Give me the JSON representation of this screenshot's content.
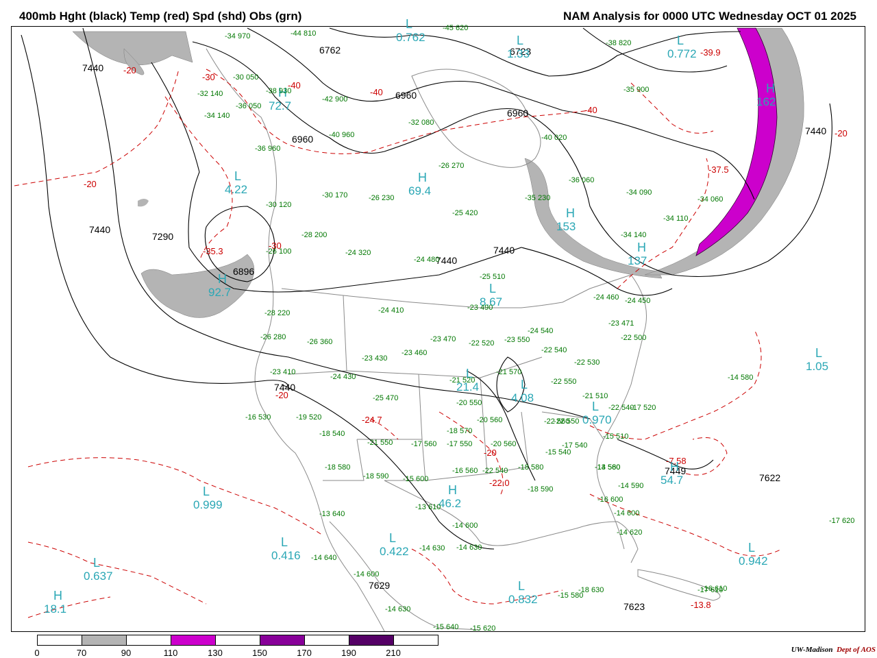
{
  "header": {
    "title_left": "400mb Hght (black) Temp (red) Spd (shd) Obs (grn)",
    "title_right": "NAM Analysis for 0000 UTC Wednesday  OCT 01 2025"
  },
  "colors": {
    "height": "#000000",
    "temp": "#cc0000",
    "obs": "#007700",
    "speed_label": "#2aa7b5",
    "shade_70_90": "#b4b4b4",
    "shade_110_130": "#cc00cc",
    "shade_150_170": "#880099",
    "shade_190_210": "#550066"
  },
  "legend": {
    "ticks": [
      "0",
      "70",
      "90",
      "110",
      "130",
      "150",
      "170",
      "190",
      "210"
    ],
    "segments": [
      "#ffffff",
      "#b4b4b4",
      "#ffffff",
      "#cc00cc",
      "#ffffff",
      "#880099",
      "#ffffff",
      "#550066",
      "#ffffff"
    ]
  },
  "credit": {
    "org": "UW-Madison",
    "dept": "Dept of AOS"
  },
  "height_labels": [
    "7440",
    "7440",
    "6762",
    "6723",
    "6960",
    "6960",
    "6960",
    "7440",
    "7290",
    "6896",
    "7440",
    "7440",
    "7440",
    "7449",
    "7622",
    "7629",
    "7623"
  ],
  "temp_labels": [
    "-20",
    "-30",
    "-40",
    "-40",
    "-40",
    "-39.9",
    "-20",
    "-37.5",
    "-20",
    "-35.3",
    "-30",
    "-20",
    "-24.7",
    "-20",
    "-22.0",
    "-7.58",
    "-13.8"
  ],
  "speed_centers": [
    {
      "type": "L",
      "value": "0.762"
    },
    {
      "type": "L",
      "value": "1.33"
    },
    {
      "type": "L",
      "value": "0.772"
    },
    {
      "type": "H",
      "value": "72.7"
    },
    {
      "type": "H",
      "value": "162"
    },
    {
      "type": "L",
      "value": "4.22"
    },
    {
      "type": "H",
      "value": "69.4"
    },
    {
      "type": "H",
      "value": "153"
    },
    {
      "type": "H",
      "value": "92.7"
    },
    {
      "type": "H",
      "value": "137"
    },
    {
      "type": "L",
      "value": "8.67"
    },
    {
      "type": "L",
      "value": "1.05"
    },
    {
      "type": "L",
      "value": "21.4"
    },
    {
      "type": "L",
      "value": "4.08"
    },
    {
      "type": "L",
      "value": "0.970"
    },
    {
      "type": "L",
      "value": "0.999"
    },
    {
      "type": "H",
      "value": "54.7"
    },
    {
      "type": "H",
      "value": "46.2"
    },
    {
      "type": "L",
      "value": "0.416"
    },
    {
      "type": "L",
      "value": "0.422"
    },
    {
      "type": "L",
      "value": "0.637"
    },
    {
      "type": "H",
      "value": "18.1"
    },
    {
      "type": "L",
      "value": "0.832"
    },
    {
      "type": "L",
      "value": "0.942"
    }
  ],
  "observations": [
    "-34 970",
    "-44 810",
    "-45 620",
    "-38 820",
    "-30 050",
    "-35 900",
    "-32 140",
    "-36 050",
    "-34 140",
    "-38 930",
    "-42 900",
    "-32 080",
    "-40 960",
    "-36 960",
    "-30 170",
    "-26 270",
    "-40 020",
    "-36 060",
    "-34 090",
    "-35 230",
    "-34 060",
    "-30 120",
    "-26 230",
    "-25 420",
    "-34 110",
    "-34 140",
    "-28 200",
    "-26 100",
    "-24 320",
    "-24 480",
    "-25 510",
    "-24 460",
    "-24 450",
    "-28 220",
    "-24 410",
    "-23 490",
    "-23 471",
    "-26 280",
    "-26 360",
    "-23 470",
    "-22 520",
    "-23 550",
    "-24 540",
    "-22 500",
    "-23 410",
    "-23 430",
    "-23 460",
    "-22 540",
    "-22 530",
    "-24 430",
    "-21 520",
    "-21 570",
    "-22 550",
    "-21 510",
    "-25 470",
    "-20 550",
    "-22 540",
    "-17 520",
    "-16 530",
    "-19 520",
    "-18 540",
    "-20 560",
    "-22 560",
    "-22 550",
    "-18 570",
    "-21 550",
    "-17 560",
    "-17 550",
    "-20 560",
    "-15 540",
    "-15 510",
    "-17 540",
    "-18 580",
    "-18 590",
    "-15 600",
    "-16 560",
    "-22 540",
    "-18 580",
    "-18 590",
    "-13 560",
    "-14 580",
    "-14 590",
    "-16 600",
    "-13 640",
    "-13 610",
    "-14 600",
    "-14 600",
    "-14 620",
    "-14 630",
    "-14 630",
    "-14 640",
    "-14 600",
    "-14 630",
    "-15 640",
    "-15 620",
    "-15 580",
    "-18 630",
    "-17 620",
    "-16 610",
    "-17 610",
    "-14 580"
  ]
}
